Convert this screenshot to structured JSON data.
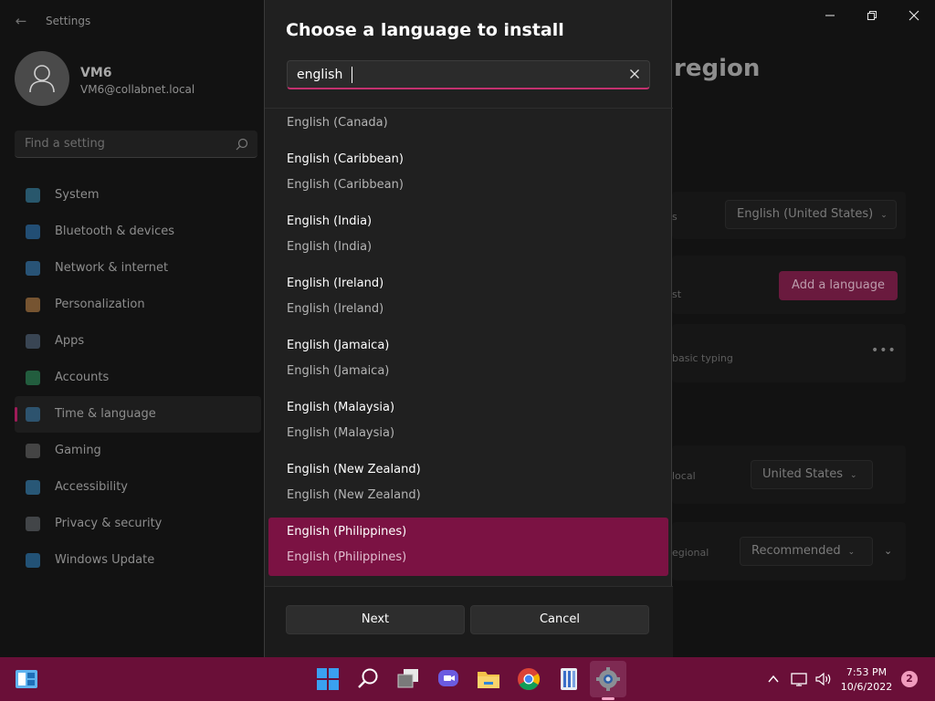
{
  "window": {
    "app_title": "Settings"
  },
  "profile": {
    "name": "VM6",
    "email": "VM6@collabnet.local"
  },
  "search_settings": {
    "placeholder": "Find a setting"
  },
  "sidebar": {
    "items": [
      {
        "label": "System",
        "icon": "monitor-icon",
        "color": "#3a8fb7"
      },
      {
        "label": "Bluetooth & devices",
        "icon": "bluetooth-icon",
        "color": "#2f7fc4"
      },
      {
        "label": "Network & internet",
        "icon": "wifi-icon",
        "color": "#3a88c8"
      },
      {
        "label": "Personalization",
        "icon": "brush-icon",
        "color": "#c88a4a"
      },
      {
        "label": "Apps",
        "icon": "apps-icon",
        "color": "#5a6f88"
      },
      {
        "label": "Accounts",
        "icon": "person-icon",
        "color": "#2f9a62"
      },
      {
        "label": "Time & language",
        "icon": "globe-clock-icon",
        "color": "#3a7fb0",
        "active": true
      },
      {
        "label": "Gaming",
        "icon": "gamepad-icon",
        "color": "#6d6d6d"
      },
      {
        "label": "Accessibility",
        "icon": "accessibility-icon",
        "color": "#3a8fc8"
      },
      {
        "label": "Privacy & security",
        "icon": "shield-icon",
        "color": "#6a6f75"
      },
      {
        "label": "Windows Update",
        "icon": "update-icon",
        "color": "#2f86c8"
      }
    ]
  },
  "page": {
    "heading": "region",
    "frag_s": "s",
    "windows_display_language": "English (United States)",
    "frag_st": "st",
    "add_language_label": "Add a language",
    "frag_typing": "basic typing",
    "frag_local": "local",
    "country_value": "United States",
    "frag_regional": "egional",
    "regional_format_value": "Recommended"
  },
  "dialog": {
    "title": "Choose a language to install",
    "search_value": "english",
    "languages": [
      {
        "name": "English (Canada)",
        "native": "English (Canada)"
      },
      {
        "name": "English (Caribbean)",
        "native": "English (Caribbean)"
      },
      {
        "name": "English (India)",
        "native": "English (India)"
      },
      {
        "name": "English (Ireland)",
        "native": "English (Ireland)"
      },
      {
        "name": "English (Jamaica)",
        "native": "English (Jamaica)"
      },
      {
        "name": "English (Malaysia)",
        "native": "English (Malaysia)"
      },
      {
        "name": "English (New Zealand)",
        "native": "English (New Zealand)"
      },
      {
        "name": "English (Philippines)",
        "native": "English (Philippines)",
        "selected": true
      }
    ],
    "next_label": "Next",
    "cancel_label": "Cancel"
  },
  "taskbar": {
    "time": "7:53 PM",
    "date": "10/6/2022",
    "notifications": "2"
  },
  "colors": {
    "accent": "#7b1243",
    "taskbar": "#6a0f38"
  }
}
